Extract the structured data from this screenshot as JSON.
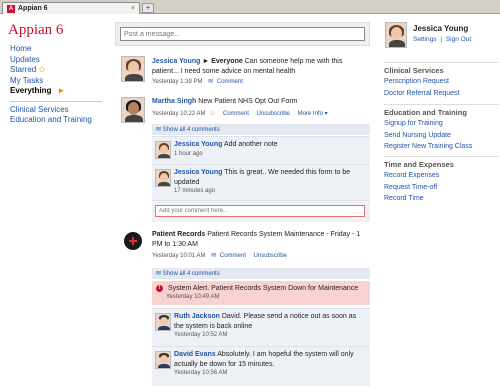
{
  "browser": {
    "tab_title": "Appian 6",
    "tab_close": "×",
    "new_tab": "+"
  },
  "logo": "Appian 6",
  "left_nav": {
    "items": [
      {
        "label": "Home"
      },
      {
        "label": "Updates"
      },
      {
        "label": "Starred"
      },
      {
        "label": "My Tasks"
      },
      {
        "label": "Everything"
      }
    ],
    "groups": [
      {
        "label": "Clinical Services"
      },
      {
        "label": "Education and Training"
      }
    ]
  },
  "composer": {
    "placeholder": "Post a message..."
  },
  "posts": [
    {
      "author": "Jessica Young",
      "arrow": "►",
      "target": "Everyone",
      "text": "Can someone help me with this patient... I need some advice on mental health",
      "time": "Yesterday 1:39 PM",
      "comment": "Comment"
    },
    {
      "author": "Martha Singh",
      "text": "New Patient NHS Opt Out Form",
      "time": "Yesterday 10:22 AM",
      "comment": "Comment",
      "unsubscribe": "Unsubscribe",
      "more_info": "More Info ▾",
      "show_all": "Show all 4 comments",
      "comments": [
        {
          "author": "Jessica Young",
          "text": "Add another note",
          "time": "1 hour ago"
        },
        {
          "author": "Jessica Young",
          "text": "This is great.. We needed this form to be updated",
          "time": "17 minutes ago"
        }
      ],
      "reply_placeholder": "Add your comment here..."
    },
    {
      "author": "Patient Records",
      "text": "Patient Records System Maintenance - Friday - 1 PM to 1:30 AM",
      "time": "Yesterday 10:01 AM",
      "comment": "Comment",
      "unsubscribe": "Unsubscribe",
      "show_all": "Show all 4 comments",
      "alert": {
        "text": "System Alert. Patient Records System Down for Maintenance",
        "time": "Yesterday 10:49 AM"
      },
      "comments": [
        {
          "author": "Ruth Jackson",
          "text": "David. Please send a notice out as soon as the system is back online",
          "time": "Yesterday 10:52 AM"
        },
        {
          "author": "David Evans",
          "text": "Absolutely. I am hopeful the system will only actually be down for 15 minutes.",
          "time": "Yesterday 10:56 AM"
        }
      ]
    }
  ],
  "user": {
    "name": "Jessica Young",
    "settings": "Settings",
    "separator": "|",
    "sign_out": "Sign Out"
  },
  "right_sections": [
    {
      "title": "Clinical Services",
      "links": [
        "Perscription Request",
        "Doctor Referral Request"
      ]
    },
    {
      "title": "Education and Training",
      "links": [
        "Signup for Training",
        "Send Nursing Update",
        "Register New Training Class"
      ]
    },
    {
      "title": "Time and Expenses",
      "links": [
        "Record Expenses",
        "Request Time-off",
        "Record Time"
      ]
    }
  ],
  "colors": {
    "brand": "#c8102e",
    "link": "#2255aa",
    "alert_bg": "#f9d2d2"
  }
}
